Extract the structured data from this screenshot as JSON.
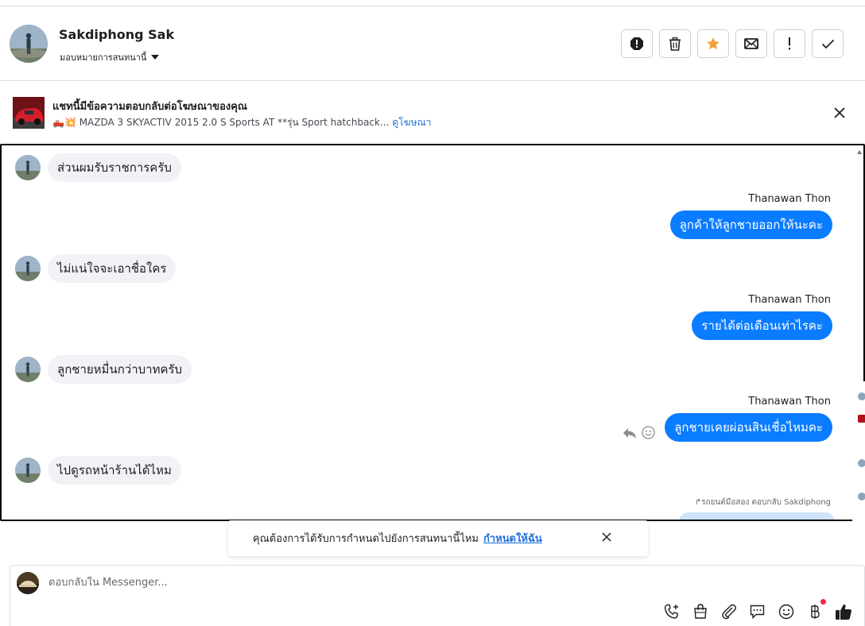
{
  "header": {
    "contact_name": "Sakdiphong Sak",
    "assign_label": "มอบหมายการสนทนานี้"
  },
  "actions": [
    "spam-icon",
    "trash-icon",
    "star-icon",
    "mail-icon",
    "exclamation-icon",
    "check-icon"
  ],
  "colors": {
    "accent": "#0a7cff",
    "star": "#f29d38",
    "link": "#216fdb"
  },
  "ad": {
    "title": "แชทนี้มีข้อความตอบกลับต่อโฆษณาของคุณ",
    "description": "🛻💥 MAZDA 3 SKYACTIV 2015 2.0 S Sports AT **รุ่น Sport hatchback...",
    "link": "ดูโฆษณา"
  },
  "conversation": {
    "incoming": [
      "ส่วนผมรับราชการครับ",
      "ไม่แน่ใจจะเอาชื่อใคร",
      "ลูกชายหมื่นกว่าบาทครับ",
      "ไปดูรถหน้าร้านได้ไหม"
    ],
    "outgoing": [
      {
        "sender": "Thanawan Thon",
        "text": "ลูกค้าให้ลูกชายออกให้นะคะ"
      },
      {
        "sender": "Thanawan Thon",
        "text": "รายได้ต่อเดือนเท่าไรคะ"
      },
      {
        "sender": "Thanawan Thon",
        "text": "ลูกชายเคยผ่อนสินเชื่อไหมคะ"
      }
    ],
    "reply_note": "↱รถยนต์มือสอง ตอบกลับ Sakdiphong"
  },
  "toast": {
    "text": "คุณต้องการได้รับการกำหนดไปยังการสนทนานี้ไหม",
    "link": "กำหนดให้ฉัน"
  },
  "composer": {
    "placeholder": "ตอบกลับใน Messenger...",
    "tools": [
      "phone-add-icon",
      "shopping-bag-icon",
      "attachment-icon",
      "saved-reply-icon",
      "emoji-icon",
      "baht-icon",
      "like-icon"
    ]
  }
}
